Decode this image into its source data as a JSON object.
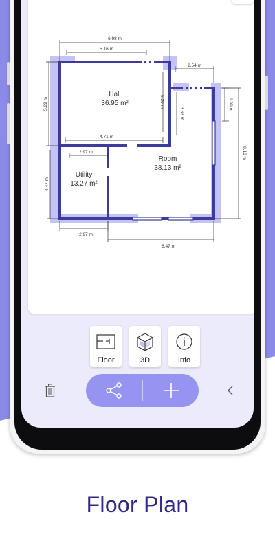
{
  "floor_plan": {
    "dimensions": {
      "top_total": "6.98 m",
      "top_hall": "5.16 m",
      "top_notch": "2.54 m",
      "left_hall": "5.29 m",
      "left_utility": "4.47 m",
      "hall_right": "5.29 m",
      "room_left": "3.63 m",
      "right_upper": "1.99 m",
      "right_total": "8.10 m",
      "hall_bottom": "4.71 m",
      "utility_top": "2.97 m",
      "bottom_utility": "2.97 m",
      "bottom_room": "6.47 m"
    },
    "rooms": [
      {
        "name": "Hall",
        "area": "36.95 m²"
      },
      {
        "name": "Room",
        "area": "38.13 m²"
      },
      {
        "name": "Utility",
        "area": "13.27 m²"
      }
    ]
  },
  "toolbar": {
    "floor_label": "Floor",
    "threed_label": "3D",
    "info_label": "Info"
  },
  "colors": {
    "accent": "#8c8ae9",
    "wall": "#3d3b9e",
    "wall_shadow": "#c4c3f6",
    "title": "#2b2a86"
  },
  "icons": {
    "floor": "floor-plan-icon",
    "threed": "cube-3d-icon",
    "info": "info-icon",
    "trash": "trash-icon",
    "share": "share-icon",
    "add": "plus-icon",
    "back": "chevron-left-icon"
  },
  "caption": "Floor Plan"
}
